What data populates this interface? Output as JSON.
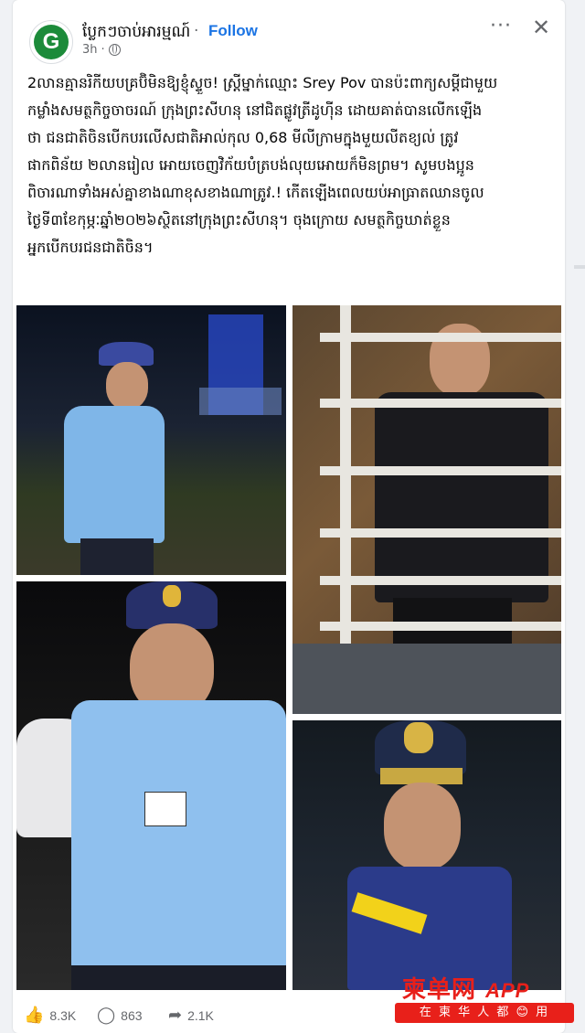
{
  "post": {
    "page_name": "ប្លែកៗចាប់អារម្មណ៍",
    "follow_label": "Follow",
    "time": "3h",
    "more_label": "···",
    "close_label": "✕",
    "text": "2លានគ្មានរិកីយបគ្រប៊ិមិនឱ្យខ្ញុំស្ទួច! ស្ត្រីម្នាក់ឈ្មោះ Srey Pov បានប៉ះពាក្យសម្តីជាមួយ\nកម្លាំងសមត្ថកិច្ចចាចរណ៍ ក្រុងព្រះសីហនុ នៅជិតផ្លូវត្រីដូហ៊ីន ដោយគាត់បានលើកឡើង\nថា ជនជាតិចិនបើកបរលើសជាតិអាល់កុល 0,68 មីលីក្រាមក្នុងមួយលីតខ្យល់ ត្រូវ\nផាកពិន័យ ២លានរៀល អោយចេញវិក័យបំត្របង់លុយអោយក៏មិនព្រម។ សូមបងប្អូន\nពិចារណាទាំងអស់គ្នាខាងណាខុសខាងណាត្រូវ.! កើតឡើងពេលយប់អាធ្រាតឈានចូល\nថ្ងៃទី៣ខែកុម្ភៈឆ្នាំ២០២៦ស្ថិតនៅក្រុងព្រះសីហនុ។ ចុងក្រោយ សមត្ថកិច្ចឃាត់ខ្លួន\nអ្នកបើកបរជនជាតិចិន។"
  },
  "avatar_letter": "G",
  "stats": {
    "likes": "8.3K",
    "comments": "863",
    "shares": "2.1K"
  },
  "watermark": {
    "brand": "柬单网",
    "app": "APP",
    "slogan": "在 柬 华 人 都 😊 用"
  },
  "colors": {
    "follow": "#1b74e4",
    "watermark": "#e8201a",
    "avatar": "#1c8b3a"
  }
}
